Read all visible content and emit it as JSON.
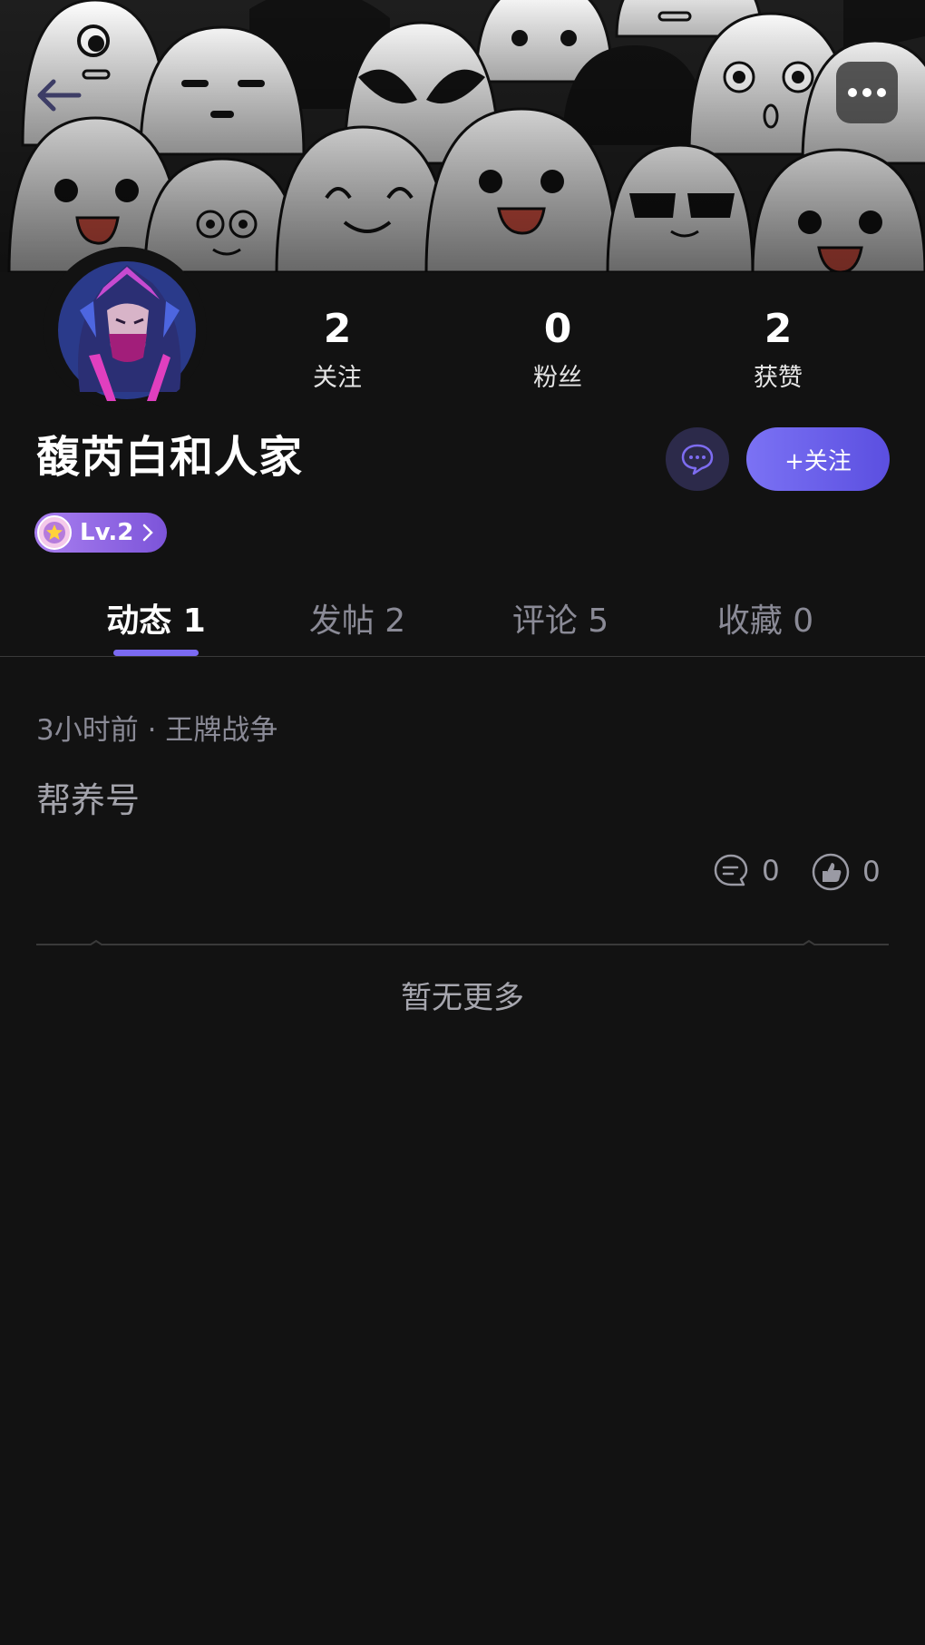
{
  "header": {
    "back_icon": "arrow-left-icon",
    "more_icon": "ellipsis-icon"
  },
  "profile": {
    "username": "馥芮白和人家",
    "level_label": "Lv.2",
    "stats": [
      {
        "value": "2",
        "label": "关注"
      },
      {
        "value": "0",
        "label": "粉丝"
      },
      {
        "value": "2",
        "label": "获赞"
      }
    ],
    "follow_label": "+关注",
    "chat_icon": "message-bubble-icon"
  },
  "tabs": [
    {
      "label": "动态 1",
      "active": true
    },
    {
      "label": "发帖 2",
      "active": false
    },
    {
      "label": "评论 5",
      "active": false
    },
    {
      "label": "收藏 0",
      "active": false
    }
  ],
  "post": {
    "meta": "3小时前 · 王牌战争",
    "body": "帮养号",
    "comment_count": "0",
    "like_count": "0"
  },
  "footer": {
    "no_more": "暂无更多"
  },
  "colors": {
    "background": "#121212",
    "accent": "#7b6af2",
    "muted_text": "#8a8a96"
  }
}
